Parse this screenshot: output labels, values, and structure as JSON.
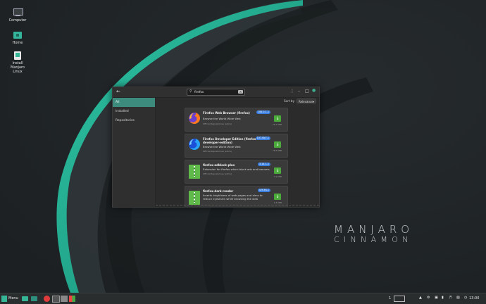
{
  "desktop": {
    "icons": [
      {
        "label": "Computer",
        "icon": "computer-icon"
      },
      {
        "label": "Home",
        "icon": "home-folder-icon"
      },
      {
        "label": "Install Manjaro Linux",
        "icon": "install-icon"
      }
    ],
    "brand_line1": "MANJARO",
    "brand_line2": "CINNAMON"
  },
  "colors": {
    "accent": "#3c8b7d",
    "install_button": "#4caa3c",
    "version_badge": "#3b7fe0"
  },
  "window": {
    "search": {
      "value": "firefox",
      "placeholder": "Search"
    },
    "sidebar": {
      "items": [
        "All",
        "Installed",
        "Repositories"
      ],
      "active": "All"
    },
    "sort": {
      "label": "Sort by",
      "value": "Relevance"
    },
    "results": [
      {
        "name": "Firefox Web Browser (firefox)",
        "description": "Browse the World Wide Web",
        "origin": "Official Repositories (extra)",
        "version": "106.0.1-1",
        "size": "76.7 MiB"
      },
      {
        "name": "Firefox Developer Edition (firefox-developer-edition)",
        "description": "Browse the World Wide Web",
        "origin": "Official Repositories (extra)",
        "version": "107.0b7-1",
        "size": "78.5 MiB"
      },
      {
        "name": "firefox-adblock-plus",
        "description": "Extension for firefox which block ads and banners",
        "origin": "Official Repositories (extra)",
        "version": "3.14.1-1",
        "size": "3.9 MiB"
      },
      {
        "name": "firefox-dark-reader",
        "description": "Inverts brightness of web pages and aims to reduce eyestrain while browsing the web",
        "origin": "",
        "version": "4.9.58-1",
        "size": "1.6 MiB"
      }
    ]
  },
  "taskbar": {
    "menu_label": "Menu",
    "clock": "13:00",
    "workspace": "1"
  }
}
